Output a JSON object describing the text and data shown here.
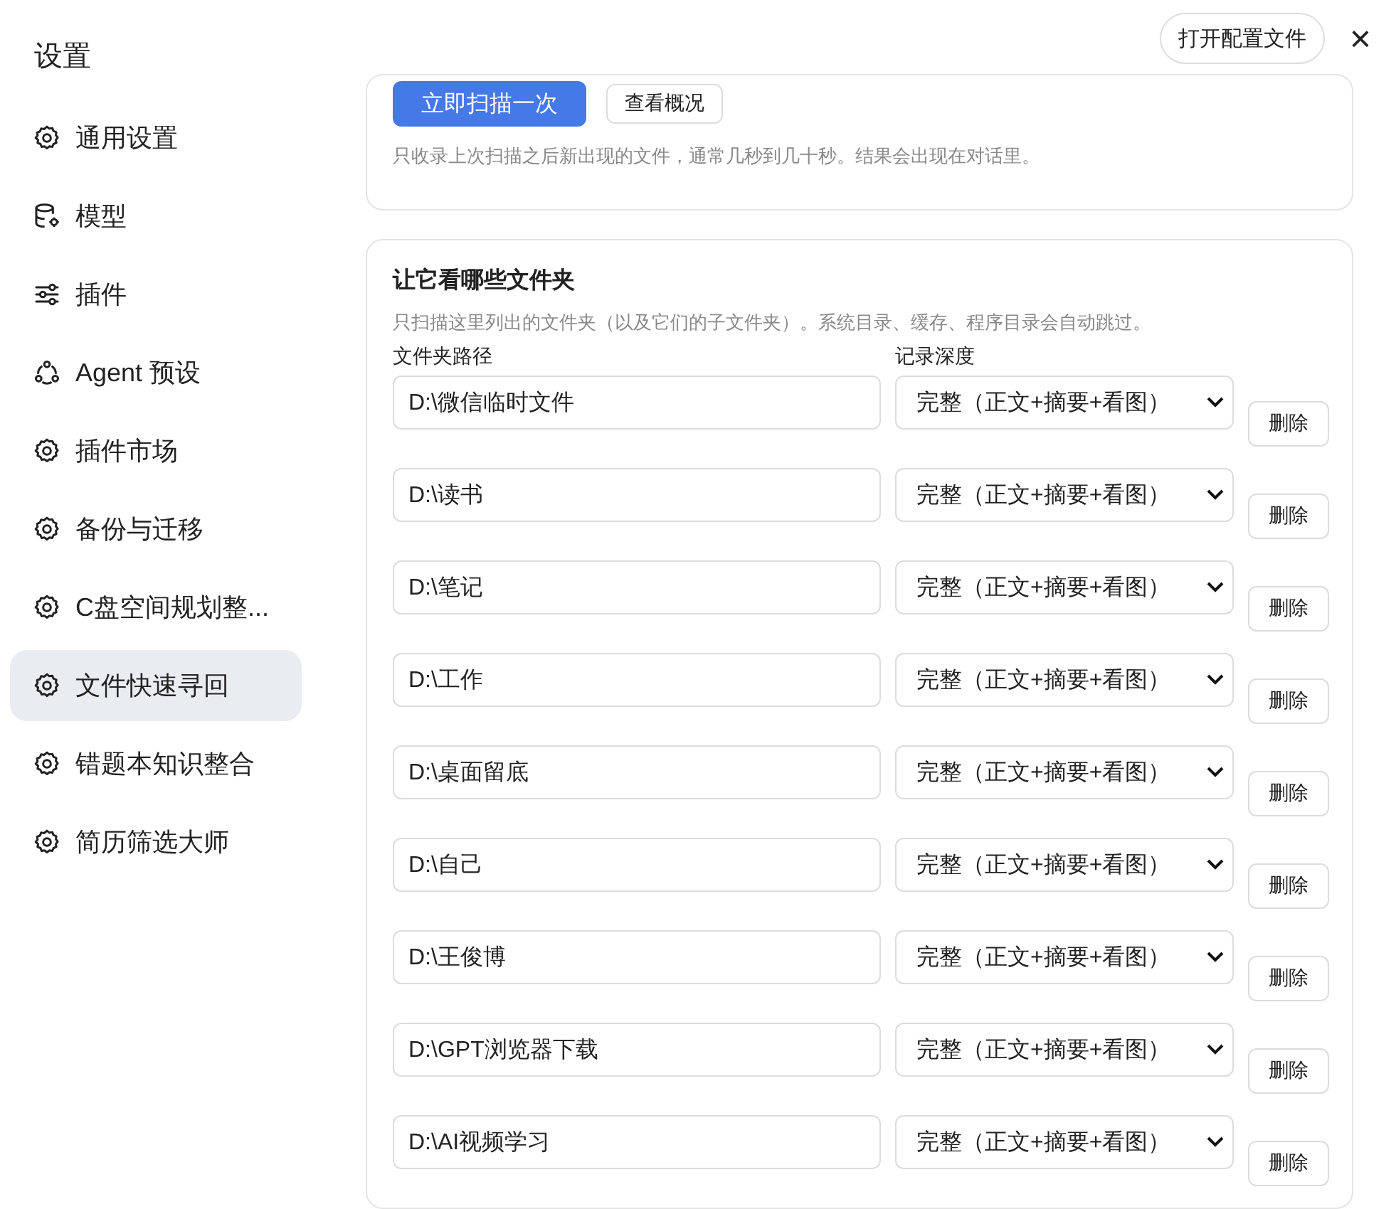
{
  "window": {
    "title": "设置",
    "open_config_button": "打开配置文件",
    "close": "×"
  },
  "sidebar": {
    "items": [
      {
        "label": "通用设置",
        "kind": "gear",
        "selected": false
      },
      {
        "label": "模型",
        "kind": "database",
        "selected": false
      },
      {
        "label": "插件",
        "kind": "sliders",
        "selected": false
      },
      {
        "label": "Agent 预设",
        "kind": "agent",
        "selected": false
      },
      {
        "label": "插件市场",
        "kind": "gear",
        "selected": false
      },
      {
        "label": "备份与迁移",
        "kind": "gear",
        "selected": false
      },
      {
        "label": "C盘空间规划整...",
        "kind": "gear",
        "selected": false
      },
      {
        "label": "文件快速寻回",
        "kind": "gear",
        "selected": true
      },
      {
        "label": "错题本知识整合",
        "kind": "gear",
        "selected": false
      },
      {
        "label": "简历筛选大师",
        "kind": "gear",
        "selected": false
      }
    ]
  },
  "scan_card": {
    "primary_button": "立即扫描一次",
    "secondary_button": "查看概况",
    "hint": "只收录上次扫描之后新出现的文件，通常几秒到几十秒。结果会出现在对话里。"
  },
  "folders_card": {
    "title": "让它看哪些文件夹",
    "description": "只扫描这里列出的文件夹（以及它们的子文件夹）。系统目录、缓存、程序目录会自动跳过。",
    "path_column": "文件夹路径",
    "depth_column": "记录深度",
    "rows": [
      {
        "path": "D:\\微信临时文件",
        "depth": "完整（正文+摘要+看图）",
        "delete": "删除"
      },
      {
        "path": "D:\\读书",
        "depth": "完整（正文+摘要+看图）",
        "delete": "删除"
      },
      {
        "path": "D:\\笔记",
        "depth": "完整（正文+摘要+看图）",
        "delete": "删除"
      },
      {
        "path": "D:\\工作",
        "depth": "完整（正文+摘要+看图）",
        "delete": "删除"
      },
      {
        "path": "D:\\桌面留底",
        "depth": "完整（正文+摘要+看图）",
        "delete": "删除"
      },
      {
        "path": "D:\\自己",
        "depth": "完整（正文+摘要+看图）",
        "delete": "删除"
      },
      {
        "path": "D:\\王俊博",
        "depth": "完整（正文+摘要+看图）",
        "delete": "删除"
      },
      {
        "path": "D:\\GPT浏览器下载",
        "depth": "完整（正文+摘要+看图）",
        "delete": "删除"
      },
      {
        "path": "D:\\AI视频学习",
        "depth": "完整（正文+摘要+看图）",
        "delete": "删除"
      }
    ]
  }
}
